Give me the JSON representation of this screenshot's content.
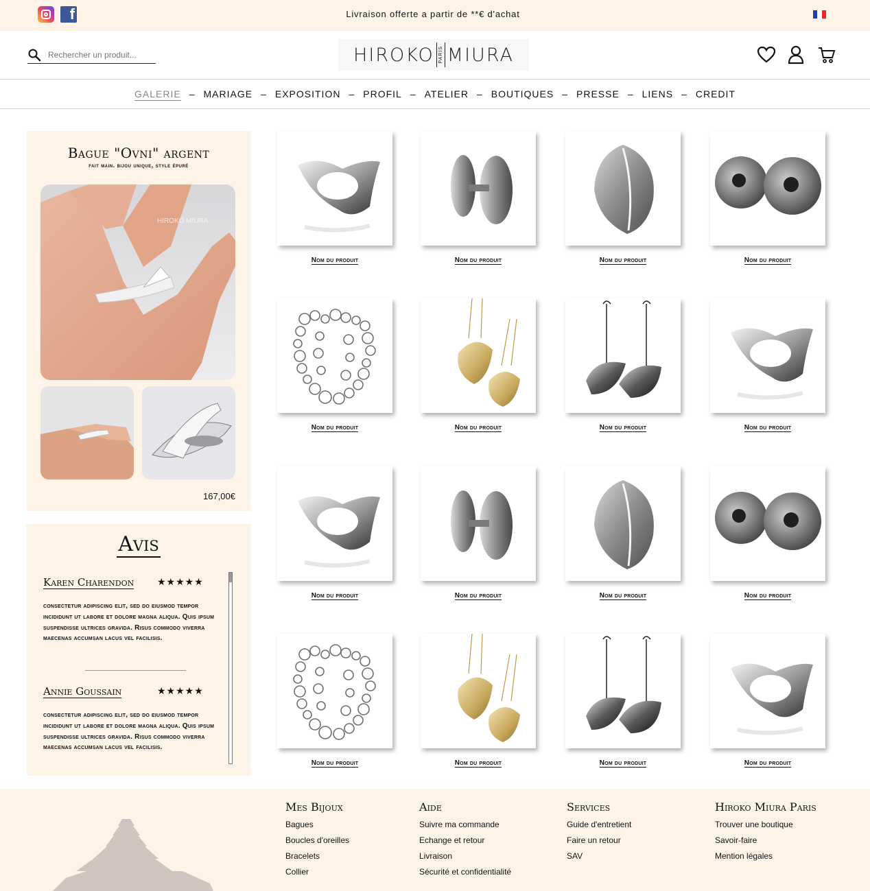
{
  "topbar": {
    "announcement": "Livraison offerte a partir de **€ d'achat",
    "social": [
      "instagram-icon",
      "facebook-icon"
    ],
    "flag": "france-flag",
    "colors": {
      "background": "#fdf3e6"
    }
  },
  "header": {
    "search_placeholder": "Rechercher un produit...",
    "logo": {
      "left": "HIROKO",
      "middle": "PARIS",
      "right": "MIURA"
    },
    "icons": [
      "heart-icon",
      "user-icon",
      "cart-icon"
    ]
  },
  "nav": {
    "items": [
      "GALERIE",
      "MARIAGE",
      "EXPOSITION",
      "PROFIL",
      "ATELIER",
      "BOUTIQUES",
      "PRESSE",
      "LIENS",
      "CREDIT"
    ],
    "active": "GALERIE",
    "separator": "–"
  },
  "product": {
    "title": "Bague \"Ovni\" argent",
    "subtitle": "fait main. bijou unique, style épuré",
    "price": "167,00€",
    "watermark": "HIROKO MIURA"
  },
  "reviews": {
    "title": "Avis",
    "items": [
      {
        "name": "Karen Charendon",
        "stars": "★★★★★",
        "text": "consectetur adipiscing elit, sed do eiusmod tempor incididunt ut labore et dolore magna aliqua. Quis ipsum suspendisse ultrices gravida. Risus commodo viverra maecenas accumsan lacus vel facilisis."
      },
      {
        "name": "Annie Goussain",
        "stars": "★★★★★",
        "text": "consectetur adipiscing elit, sed do eiusmod tempor incididunt ut labore et dolore magna aliqua. Quis ipsum suspendisse ultrices gravida. Risus commodo viverra maecenas accumsan lacus vel facilisis."
      }
    ]
  },
  "grid": {
    "label": "Nom du produit",
    "items": [
      "ring",
      "cufflinks",
      "pendant",
      "earrings",
      "chain",
      "gold-pendants",
      "drop-earrings",
      "ring",
      "ring",
      "cufflinks",
      "pendant",
      "earrings",
      "chain",
      "gold-pendants",
      "drop-earrings",
      "ring"
    ]
  },
  "footer": {
    "columns": [
      {
        "title": "Mes Bijoux",
        "links": [
          "Bagues",
          "Boucles d'oreilles",
          "Bracelets",
          "Collier"
        ]
      },
      {
        "title": "Aide",
        "links": [
          "Suivre ma commande",
          "Echange et retour",
          "Livraison",
          "Sécurité et confidentialité"
        ]
      },
      {
        "title": "Services",
        "links": [
          "Guide d'entretient",
          "Faire un retour",
          "SAV"
        ]
      },
      {
        "title": "Hiroko Miura Paris",
        "links": [
          "Trouver une boutique",
          "Savoir-faire",
          "Mention légales"
        ]
      }
    ]
  }
}
